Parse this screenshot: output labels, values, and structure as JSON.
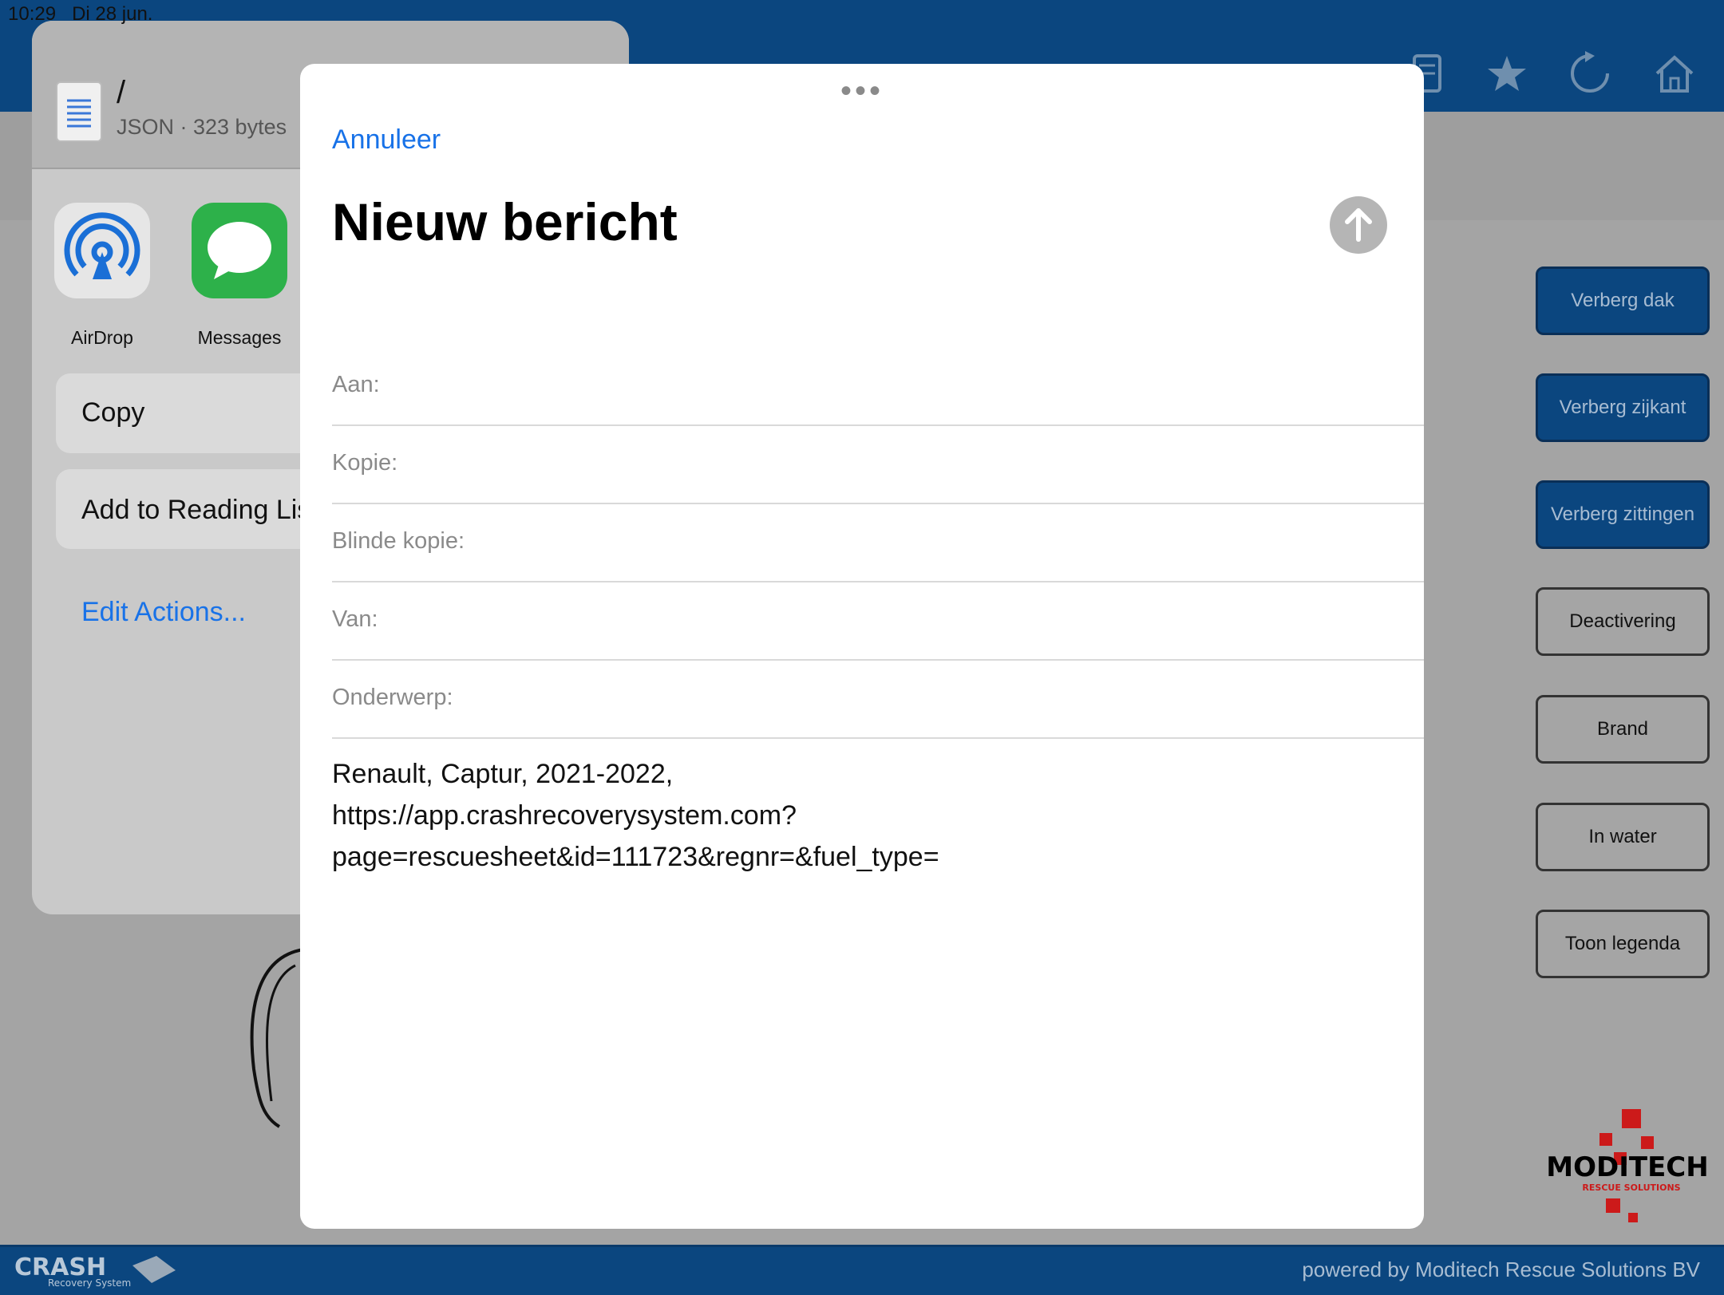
{
  "status": {
    "time": "10:29",
    "date": "Di 28 jun."
  },
  "app": {
    "footer": "powered by Moditech Rescue Solutions BV",
    "side_buttons": [
      {
        "label": "Verberg dak",
        "style": "blue"
      },
      {
        "label": "Verberg zijkant",
        "style": "blue"
      },
      {
        "label": "Verberg zittingen",
        "style": "blue"
      },
      {
        "label": "Deactivering",
        "style": "grey"
      },
      {
        "label": "Brand",
        "style": "grey"
      },
      {
        "label": "In water",
        "style": "grey"
      },
      {
        "label": "Toon legenda",
        "style": "grey"
      }
    ],
    "logo_text": "MODITECH",
    "logo_sub": "RESCUE SOLUTIONS",
    "crash_logo": "CRASH",
    "crash_logo_sub": "Recovery System",
    "header_icons": [
      "document-icon",
      "star-icon",
      "refresh-icon",
      "home-icon"
    ]
  },
  "share": {
    "file_name": "/",
    "file_meta": "JSON · 323 bytes",
    "apps": [
      {
        "label": "AirDrop",
        "icon": "airdrop-icon"
      },
      {
        "label": "Messages",
        "icon": "messages-icon"
      }
    ],
    "actions": [
      "Copy",
      "Add to Reading Lis"
    ],
    "edit_actions": "Edit Actions..."
  },
  "compose": {
    "cancel": "Annuleer",
    "title": "Nieuw bericht",
    "fields": [
      "Aan:",
      "Kopie:",
      "Blinde kopie:",
      "Van:",
      "Onderwerp:"
    ],
    "body_lines": [
      "Renault, Captur, 2021-2022,",
      "https://app.crashrecoverysystem.com?",
      "page=rescuesheet&id=111723&regnr=&fuel_type="
    ]
  },
  "colors": {
    "header_blue": "#0b467f",
    "link_blue": "#1872e8",
    "logo_red": "#cc1a1a"
  }
}
